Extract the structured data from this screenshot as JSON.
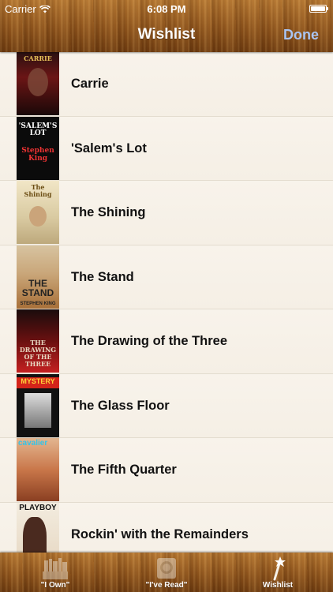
{
  "status": {
    "carrier": "Carrier",
    "time": "6:08 PM",
    "battery_level": 1.0
  },
  "nav": {
    "title": "Wishlist",
    "done_label": "Done"
  },
  "books": [
    {
      "title": "Carrie",
      "cover_text": "CARRIE",
      "cover_sub": ""
    },
    {
      "title": "'Salem's Lot",
      "cover_text": "'SALEM'S LOT",
      "cover_sub": "Stephen King"
    },
    {
      "title": "The Shining",
      "cover_text": "The Shining",
      "cover_sub": ""
    },
    {
      "title": "The Stand",
      "cover_text": "THE STAND",
      "cover_sub": "STEPHEN KING"
    },
    {
      "title": "The Drawing of the Three",
      "cover_text": "THE DRAWING OF THE THREE",
      "cover_sub": ""
    },
    {
      "title": "The Glass Floor",
      "cover_text": "MYSTERY",
      "cover_sub": ""
    },
    {
      "title": "The Fifth Quarter",
      "cover_text": "cavalier",
      "cover_sub": ""
    },
    {
      "title": "Rockin' with the Remainders",
      "cover_text": "PLAYBOY",
      "cover_sub": ""
    }
  ],
  "tabs": [
    {
      "label": "\"I Own\"",
      "icon": "bookshelf-icon",
      "selected": false
    },
    {
      "label": "\"I've Read\"",
      "icon": "open-book-icon",
      "selected": false
    },
    {
      "label": "Wishlist",
      "icon": "magic-wand-icon",
      "selected": true
    }
  ]
}
